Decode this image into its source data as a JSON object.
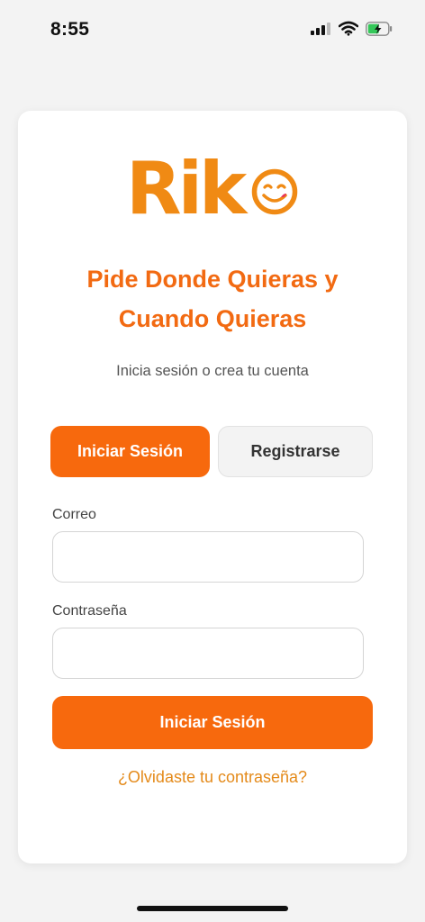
{
  "status_bar": {
    "time": "8:55"
  },
  "brand": {
    "logo_text": "Rik",
    "logo_icon": "smiley-face-icon",
    "accent_color": "#f7690d",
    "logo_color": "#f08a14"
  },
  "header": {
    "headline_line1": "Pide Donde Quieras y",
    "headline_line2": "Cuando Quieras",
    "subtitle": "Inicia sesión o crea tu cuenta"
  },
  "tabs": {
    "login": "Iniciar Sesión",
    "register": "Registrarse",
    "active": "login"
  },
  "form": {
    "email_label": "Correo",
    "email_value": "",
    "password_label": "Contraseña",
    "password_value": "",
    "submit_label": "Iniciar Sesión",
    "forgot_link": "¿Olvidaste tu contraseña?"
  }
}
